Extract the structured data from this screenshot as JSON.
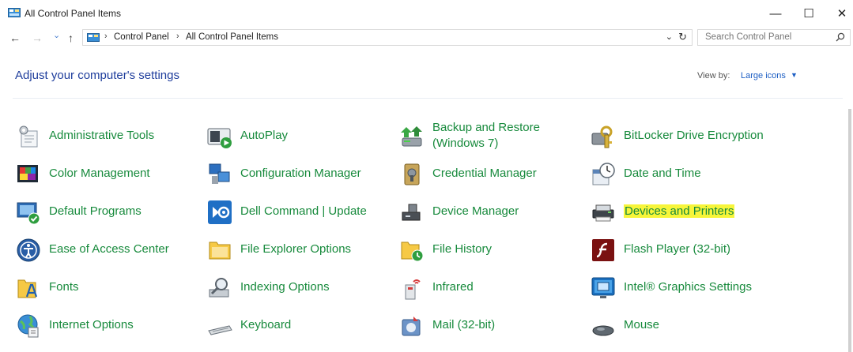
{
  "window": {
    "title": "All Control Panel Items",
    "minimize": "—",
    "maximize": "☐",
    "close": "✕"
  },
  "nav": {
    "back": "←",
    "forward": "→",
    "recent": "⌄",
    "up": "↑",
    "breadcrumbs": [
      "Control Panel",
      "All Control Panel Items"
    ],
    "separator": "›",
    "dropdown": "⌄",
    "refresh": "↻"
  },
  "search": {
    "placeholder": "Search Control Panel"
  },
  "header": {
    "title": "Adjust your computer's settings",
    "view_by_label": "View by:",
    "view_by_value": "Large icons",
    "view_by_caret": "▼"
  },
  "items": [
    {
      "label": "Administrative Tools",
      "icon": "admin-tools-icon"
    },
    {
      "label": "AutoPlay",
      "icon": "autoplay-icon"
    },
    {
      "label": "Backup and Restore (Windows 7)",
      "icon": "backup-restore-icon"
    },
    {
      "label": "BitLocker Drive Encryption",
      "icon": "bitlocker-icon"
    },
    {
      "label": "Color Management",
      "icon": "color-management-icon"
    },
    {
      "label": "Configuration Manager",
      "icon": "configuration-manager-icon"
    },
    {
      "label": "Credential Manager",
      "icon": "credential-manager-icon"
    },
    {
      "label": "Date and Time",
      "icon": "date-time-icon"
    },
    {
      "label": "Default Programs",
      "icon": "default-programs-icon"
    },
    {
      "label": "Dell Command | Update",
      "icon": "dell-command-update-icon"
    },
    {
      "label": "Device Manager",
      "icon": "device-manager-icon"
    },
    {
      "label": "Devices and Printers",
      "icon": "devices-printers-icon",
      "highlight_color": "#f7f53a"
    },
    {
      "label": "Ease of Access Center",
      "icon": "ease-of-access-icon"
    },
    {
      "label": "File Explorer Options",
      "icon": "file-explorer-options-icon"
    },
    {
      "label": "File History",
      "icon": "file-history-icon"
    },
    {
      "label": "Flash Player (32-bit)",
      "icon": "flash-player-icon"
    },
    {
      "label": "Fonts",
      "icon": "fonts-icon"
    },
    {
      "label": "Indexing Options",
      "icon": "indexing-options-icon"
    },
    {
      "label": "Infrared",
      "icon": "infrared-icon"
    },
    {
      "label": "Intel® Graphics Settings",
      "icon": "intel-graphics-icon"
    },
    {
      "label": "Internet Options",
      "icon": "internet-options-icon"
    },
    {
      "label": "Keyboard",
      "icon": "keyboard-icon"
    },
    {
      "label": "Mail (32-bit)",
      "icon": "mail-icon"
    },
    {
      "label": "Mouse",
      "icon": "mouse-icon"
    }
  ],
  "colors": {
    "item_text": "#178a3c",
    "title_text": "#1e3d9c",
    "link_blue": "#1e5fc4"
  }
}
